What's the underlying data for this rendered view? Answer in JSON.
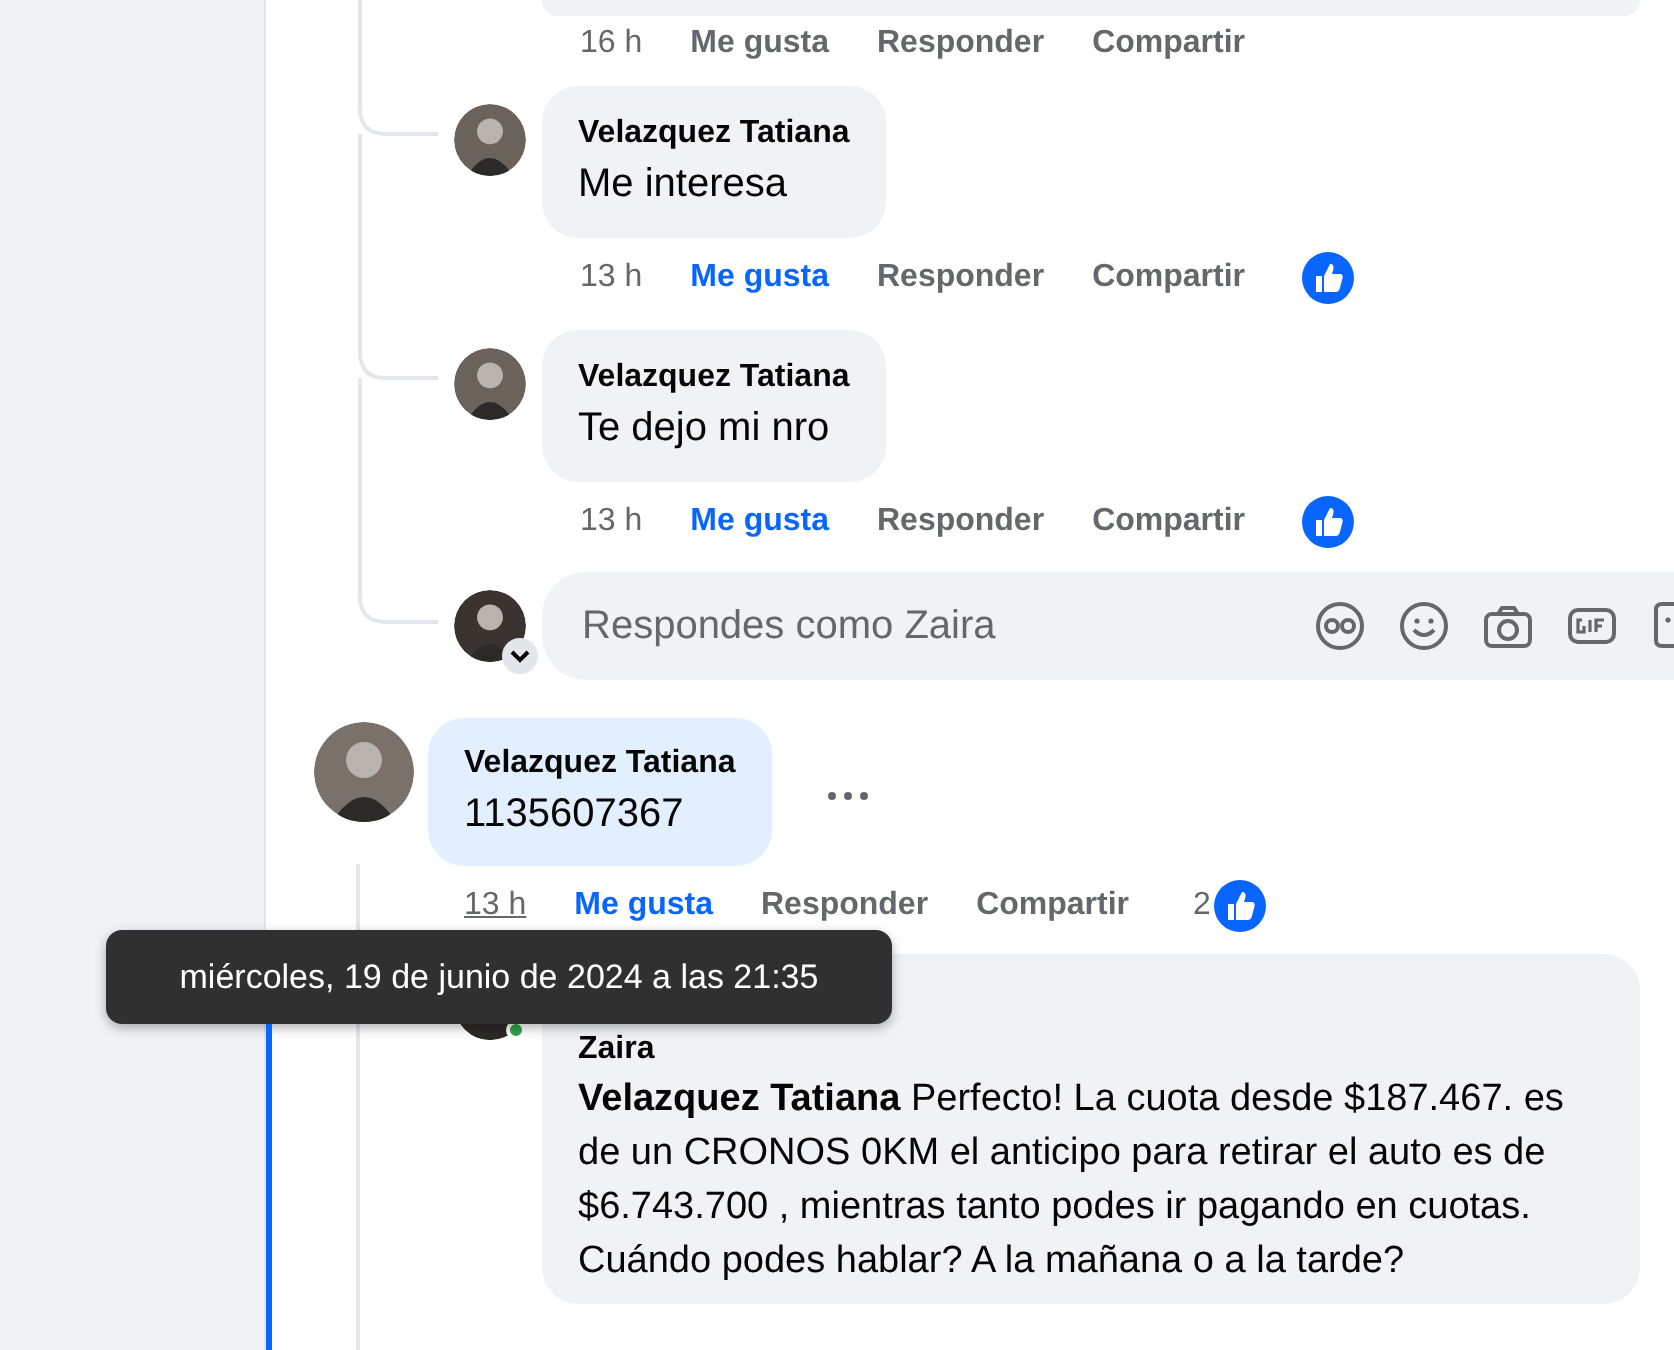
{
  "earlier_comment": {
    "time": "16 h",
    "like": "Me gusta",
    "reply": "Responder",
    "share": "Compartir",
    "liked": false
  },
  "replies": [
    {
      "author": "Velazquez Tatiana",
      "text": "Me interesa",
      "time": "13 h",
      "like": "Me gusta",
      "reply": "Responder",
      "share": "Compartir",
      "liked": true,
      "reacted": true
    },
    {
      "author": "Velazquez Tatiana",
      "text": "Te dejo mi nro",
      "time": "13 h",
      "like": "Me gusta",
      "reply": "Responder",
      "share": "Compartir",
      "liked": true,
      "reacted": true
    }
  ],
  "composer": {
    "placeholder": "Respondes como Zaira"
  },
  "comment": {
    "author": "Velazquez Tatiana",
    "text": "1135607367",
    "highlighted": true,
    "time": "13 h",
    "like": "Me gusta",
    "reply": "Responder",
    "share": "Compartir",
    "liked": true,
    "reaction_count": "2"
  },
  "answer": {
    "author": "Zaira",
    "online": true,
    "text": "**Velazquez Tatiana** Perfecto! La cuota desde $187.467. es de un CRONOS 0KM el anticipo para retirar el auto es de $6.743.700 , mientras tanto podes ir pagando en cuotas. Cuándo podes hablar? A la mañana o a la tarde?"
  },
  "tooltip": {
    "text": "miércoles, 19 de junio de 2024 a las 21:35"
  }
}
